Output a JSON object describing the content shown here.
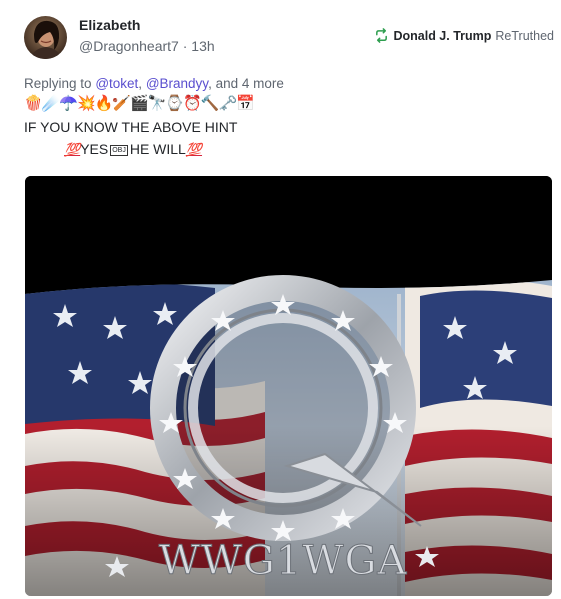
{
  "author": {
    "name": "Elizabeth",
    "handle": "@Dragonheart7",
    "separator": "·",
    "time": "13h"
  },
  "retruth": {
    "user": "Donald J. Trump",
    "action": "ReTruthed",
    "icon": "retruth-icon",
    "color": "#2e9e4f"
  },
  "reply": {
    "prefix": "Replying to",
    "mentions": [
      "@toket",
      "@Brandyy"
    ],
    "comma": ",",
    "and": "and",
    "more": "4 more"
  },
  "post": {
    "emojis": "🍿☄️☂️💥🔥🏏🎬🔭⌚⏰🔨🗝️📅",
    "line1": "IF YOU KNOW THE ABOVE HINT",
    "hundred": "💯",
    "line2_a": "YES",
    "line2_obj": "OBJ",
    "line2_b": "HE WILL"
  },
  "media": {
    "caption": "WWG1WGA",
    "colors": {
      "red": "#b21f2e",
      "blue": "#26386b",
      "silver": "#c9ccd1"
    }
  }
}
